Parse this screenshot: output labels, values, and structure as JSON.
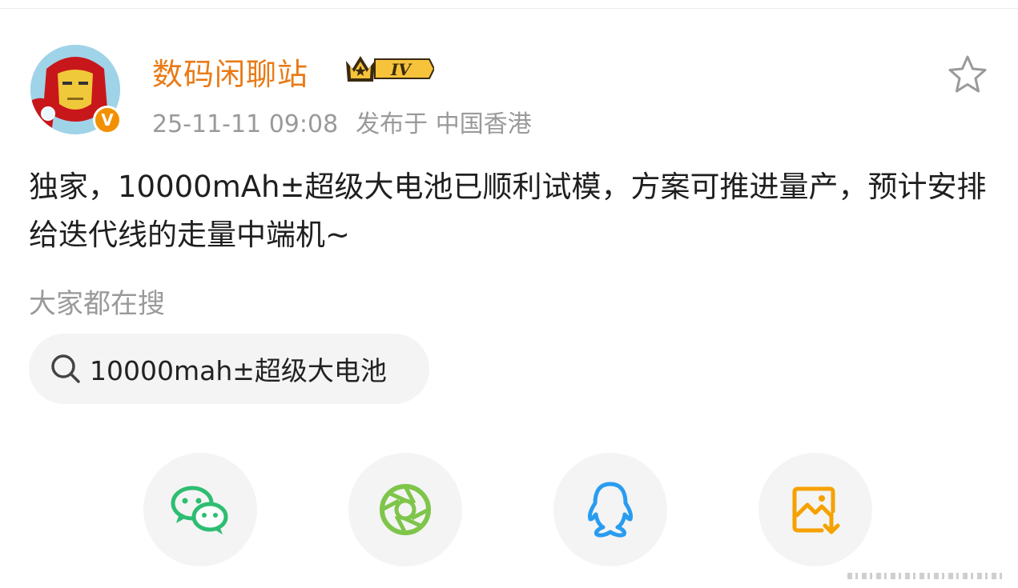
{
  "post": {
    "username": "数码闲聊站",
    "vip_level": "IV",
    "verified_mark": "V",
    "timestamp": "25-11-11 09:08",
    "location": "发布于 中国香港",
    "content": "独家，10000mAh±超级大电池已顺利试模，方案可推进量产，预计安排给迭代线的走量中端机~"
  },
  "search": {
    "label": "大家都在搜",
    "suggestion": "10000mah±超级大电池"
  },
  "icons": {
    "avatar": "iron-man-avatar",
    "favorite": "star-icon",
    "search": "search-icon",
    "share": [
      "wechat-icon",
      "moments-icon",
      "qq-icon",
      "save-image-icon"
    ]
  },
  "colors": {
    "username": "#e87b17",
    "verified": "#f29100",
    "wechat": "#2ebd72",
    "moments": "#7ec54a",
    "qq": "#2a9cf0",
    "save_image": "#f5a100"
  }
}
